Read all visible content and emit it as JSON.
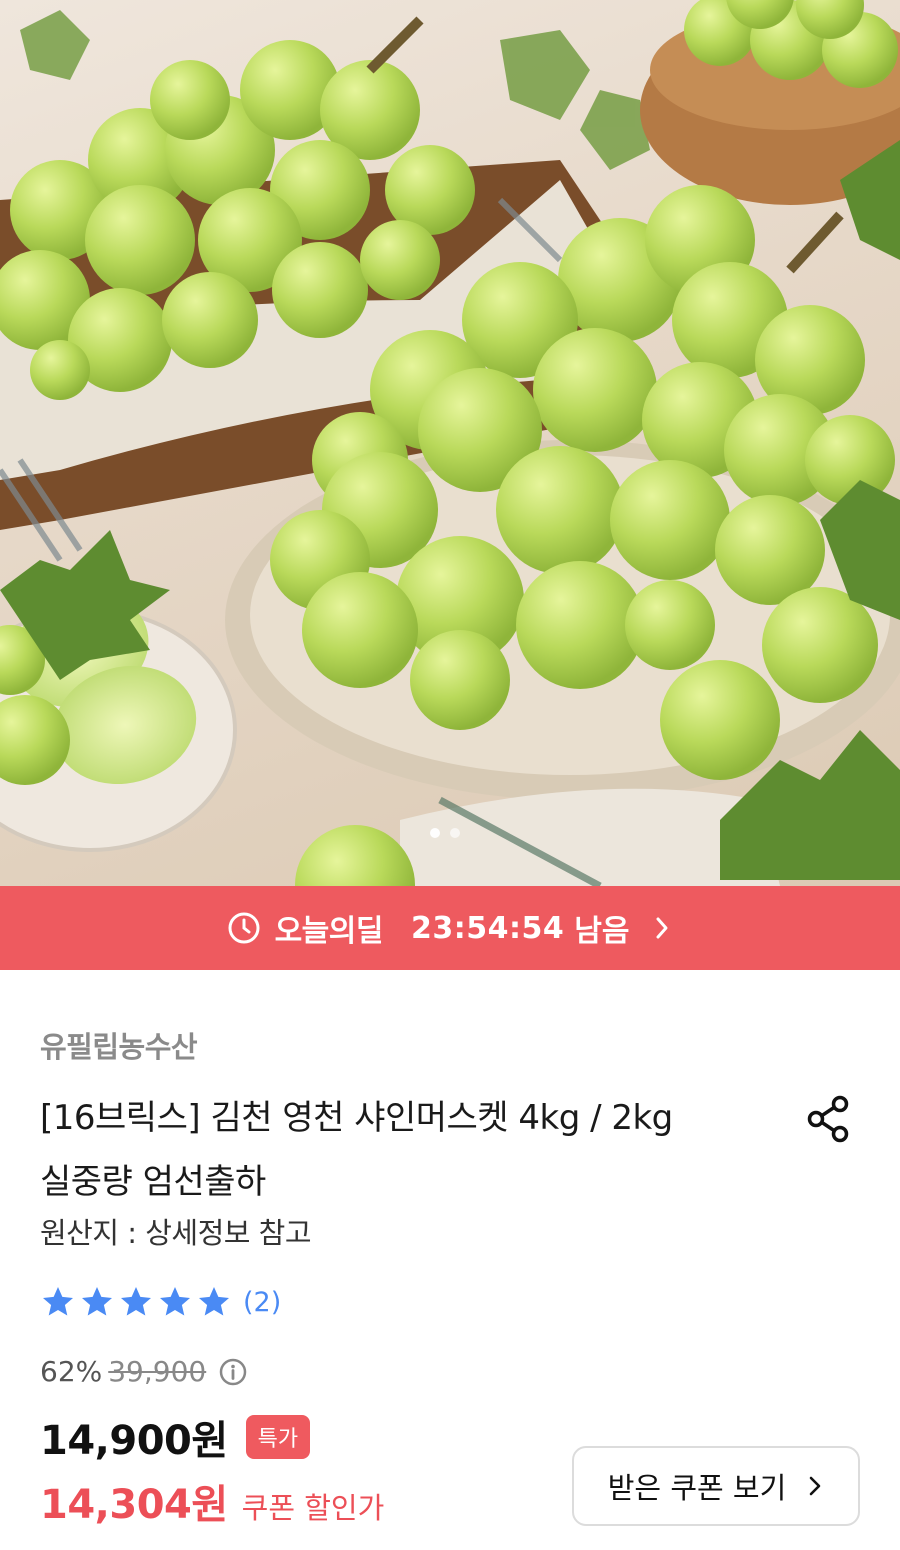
{
  "hero": {
    "image": "green shine muscat grapes on plate",
    "carousel_total": 2,
    "carousel_active": 1
  },
  "deal": {
    "label": "오늘의딜",
    "time": "23:54:54",
    "suffix": "남음",
    "bg_color": "#ee5a5f",
    "icons": [
      "clock-icon",
      "chevron-right-icon"
    ]
  },
  "product": {
    "seller": "유필립농수산",
    "title_line1": "[16브릭스] 김천 영천 샤인머스켓 4kg / 2kg",
    "title_line2": "실중량 엄선출하",
    "origin": "원산지 : 상세정보 참고",
    "rating_stars": 5,
    "review_count": "(2)",
    "discount_rate": "62%",
    "original_price": "39,900",
    "price": "14,900원",
    "price_badge": "특가",
    "coupon_price": "14,304원",
    "coupon_label": "쿠폰 할인가",
    "coupon_button": "받은 쿠폰 보기",
    "accent_color": "#ec4f57",
    "star_color": "#4a8af4"
  }
}
